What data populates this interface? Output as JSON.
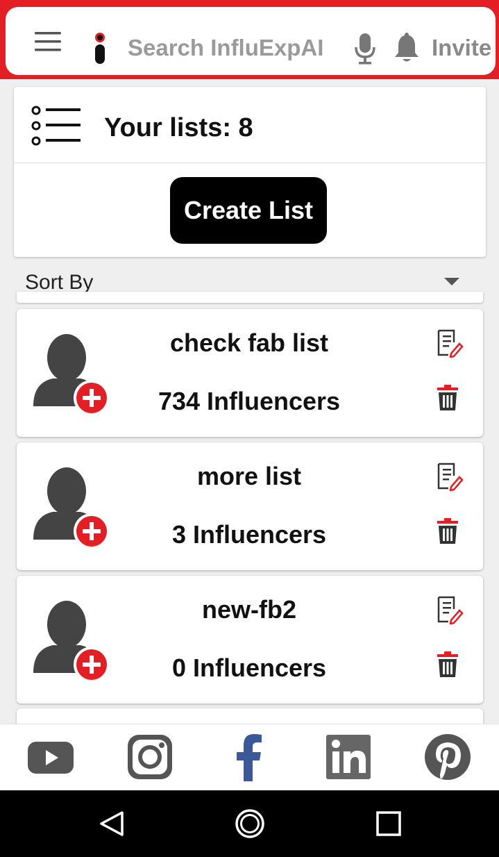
{
  "header": {
    "search_placeholder": "Search InfluExpAI",
    "invite_label": "Invite",
    "accent_color": "#e31e24"
  },
  "summary": {
    "lists_count_text": "Your lists: 8",
    "create_button_label": "Create List"
  },
  "sort": {
    "label": "Sort By"
  },
  "lists": [
    {
      "name": "check fab list",
      "count": "734 Influencers"
    },
    {
      "name": "more list",
      "count": "3 Influencers"
    },
    {
      "name": "new-fb2",
      "count": "0 Influencers"
    }
  ],
  "social": [
    "youtube-icon",
    "instagram-icon",
    "facebook-icon",
    "linkedin-icon",
    "pinterest-icon"
  ],
  "nav": [
    "back-icon",
    "home-icon",
    "recents-icon"
  ]
}
